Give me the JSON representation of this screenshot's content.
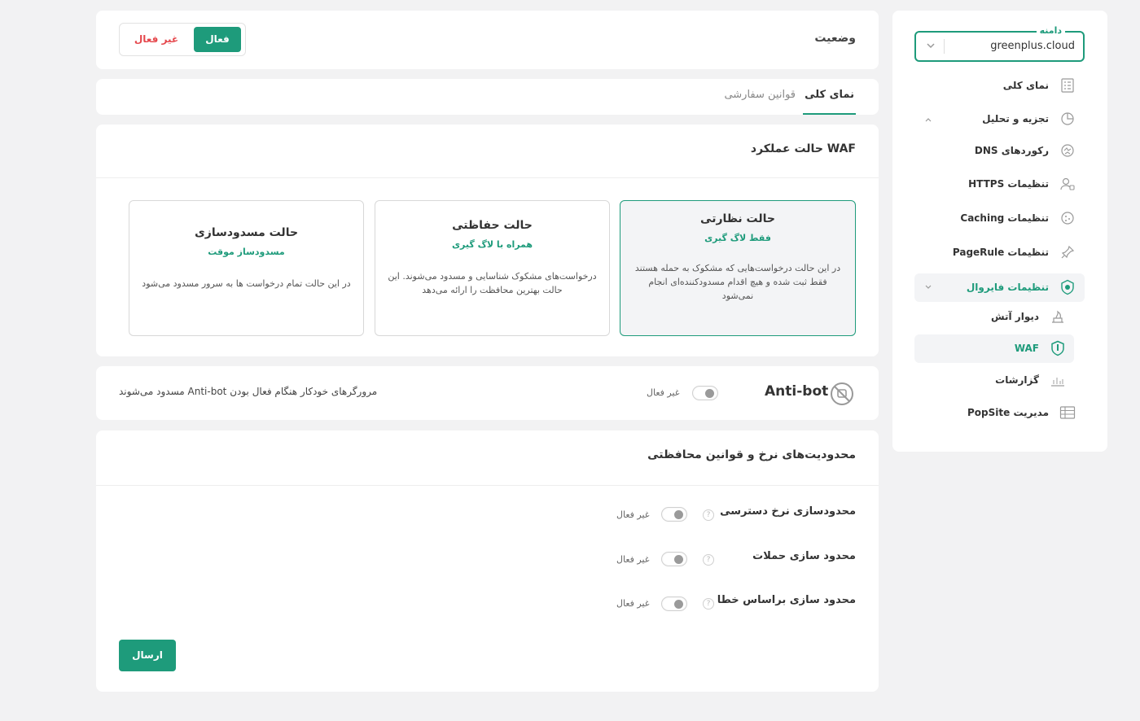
{
  "sidebar": {
    "domain_label": "دامنه",
    "domain_value": "greenplus.cloud",
    "items": [
      {
        "label": "نمای کلی",
        "icon": "overview-icon"
      },
      {
        "label": "تجزیه و تحلیل",
        "icon": "analytics-icon"
      },
      {
        "label": "رکوردهای DNS",
        "icon": "dns-icon"
      },
      {
        "label": "تنظیمات HTTPS",
        "icon": "https-icon"
      },
      {
        "label": "تنظیمات Caching",
        "icon": "cache-icon"
      },
      {
        "label": "تنظیمات PageRule",
        "icon": "pagerule-icon"
      },
      {
        "label": "تنظیمات فایروال",
        "icon": "firewall-icon"
      },
      {
        "label": "دیوار آتش",
        "icon": "firewall-wall-icon"
      },
      {
        "label": "WAF",
        "icon": "waf-shield-icon"
      },
      {
        "label": "گزارشات",
        "icon": "reports-icon"
      },
      {
        "label": "مدیریت PopSite",
        "icon": "popsite-icon"
      }
    ]
  },
  "status": {
    "label": "وضعیت",
    "active": "فعال",
    "inactive": "غیر فعال"
  },
  "tabs": [
    {
      "label": "نمای کلی"
    },
    {
      "label": "قوانین سفارشی"
    }
  ],
  "waf_mode": {
    "title": "حالت عملکرد WAF",
    "modes": [
      {
        "title": "حالت نظارتی",
        "subtitle": "فقط لاگ گیری",
        "desc": "در این حالت درخواست‌هایی که مشکوک به حمله هستند فقط ثبت شده و هیچ اقدام مسدودکننده‌ای انجام نمی‌شود"
      },
      {
        "title": "حالت حفاظتی",
        "subtitle": "همراه با لاگ گیری",
        "desc": "درخواست‌های مشکوک شناسایی و مسدود می‌شوند. این حالت بهترین محافظت را ارائه می‌دهد"
      },
      {
        "title": "حالت مسدودسازی",
        "subtitle": "مسدودساز موقت",
        "desc": "در این حالت تمام درخواست ها به سرور مسدود می‌شود"
      }
    ]
  },
  "antibot": {
    "title": "Anti-bot",
    "toggle_label": "غیر فعال",
    "desc": "مرورگرهای خودکار هنگام فعال بودن Anti-bot مسدود می‌شوند"
  },
  "rate_limits": {
    "title": "محدودیت‌های نرخ و قوانین محافظتی",
    "rows": [
      {
        "label": "محدودسازی نرخ دسترسی",
        "toggle_label": "غیر فعال"
      },
      {
        "label": "محدود سازی حملات",
        "toggle_label": "غیر فعال"
      },
      {
        "label": "محدود سازی براساس خطا",
        "toggle_label": "غیر فعال"
      }
    ],
    "submit": "ارسال"
  },
  "colors": {
    "accent": "#1e9b7b",
    "danger": "#e5484d"
  }
}
